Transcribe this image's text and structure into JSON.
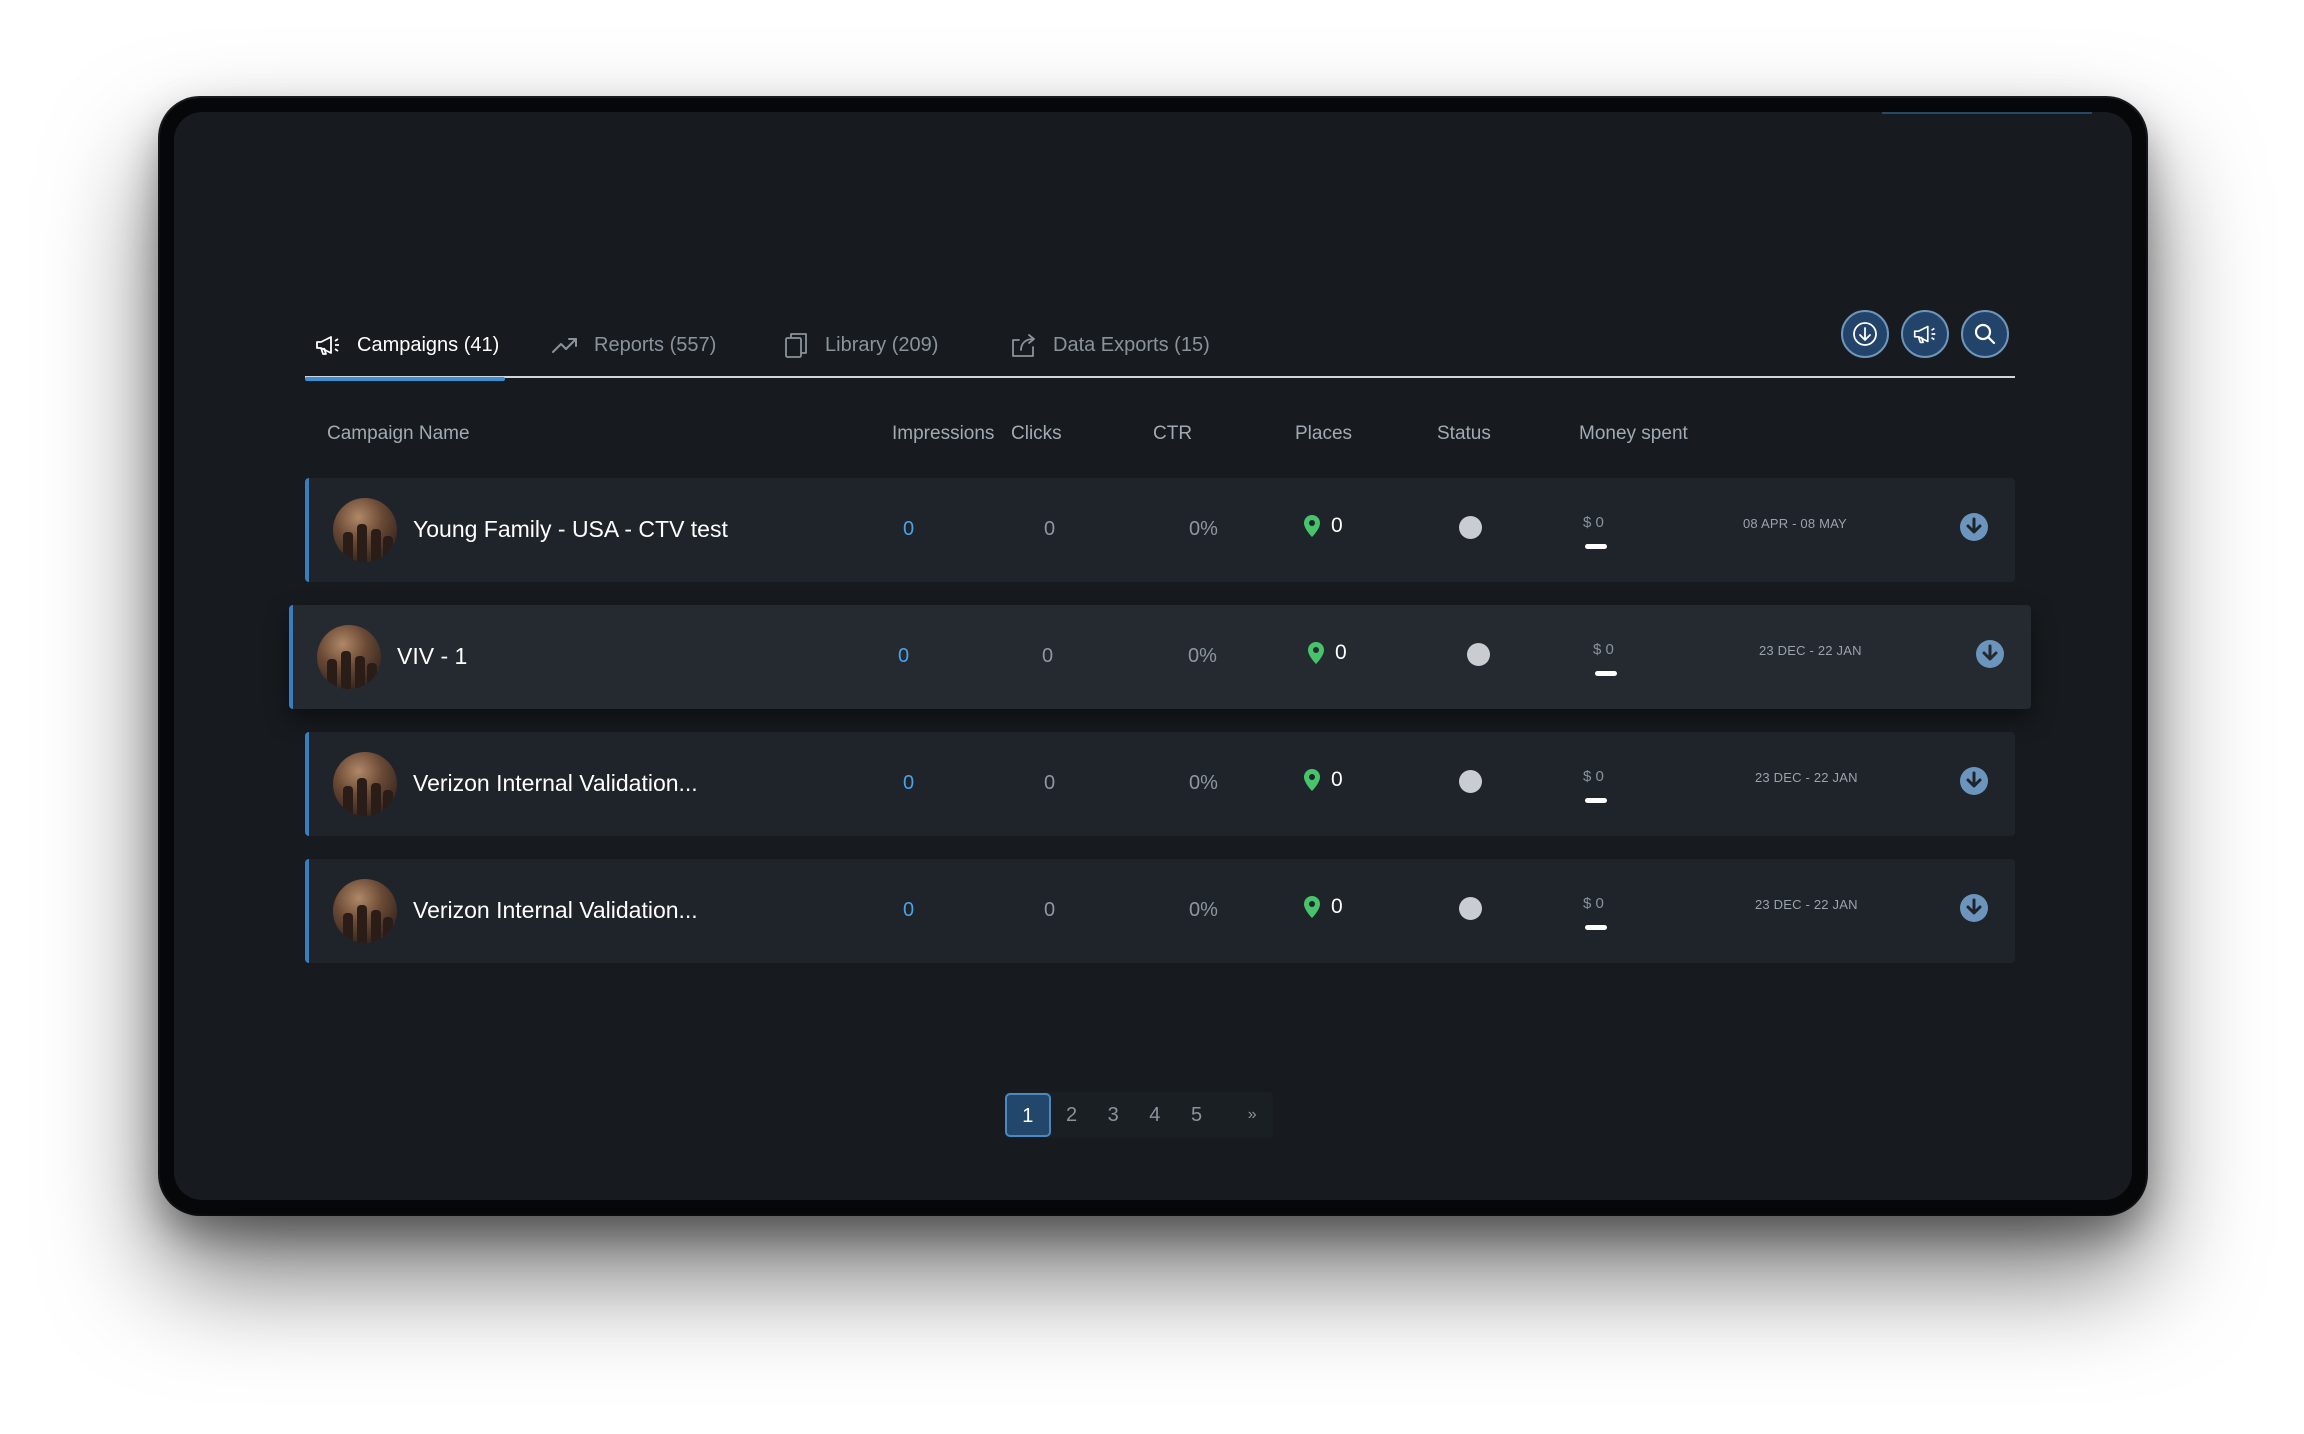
{
  "tabs": [
    {
      "label": "Campaigns (41)",
      "icon": "megaphone-icon",
      "active": true
    },
    {
      "label": "Reports (557)",
      "icon": "trend-icon",
      "active": false
    },
    {
      "label": "Library (209)",
      "icon": "copy-icon",
      "active": false
    },
    {
      "label": "Data Exports (15)",
      "icon": "share-icon",
      "active": false
    }
  ],
  "actions": [
    "download-icon",
    "megaphone-icon",
    "search-icon"
  ],
  "table": {
    "headers": [
      "Campaign Name",
      "Impressions",
      "Clicks",
      "CTR",
      "Places",
      "Status",
      "Money spent"
    ],
    "rows": [
      {
        "name": "Young Family - USA - CTV test",
        "impressions": "0",
        "clicks": "0",
        "ctr": "0%",
        "places": "0",
        "money": "$ 0",
        "dates": "08 APR - 08 MAY"
      },
      {
        "name": "VIV - 1",
        "impressions": "0",
        "clicks": "0",
        "ctr": "0%",
        "places": "0",
        "money": "$ 0",
        "dates": "23 DEC - 22 JAN"
      },
      {
        "name": "Verizon Internal Validation...",
        "impressions": "0",
        "clicks": "0",
        "ctr": "0%",
        "places": "0",
        "money": "$ 0",
        "dates": "23 DEC - 22 JAN"
      },
      {
        "name": "Verizon Internal Validation...",
        "impressions": "0",
        "clicks": "0",
        "ctr": "0%",
        "places": "0",
        "money": "$ 0",
        "dates": "23 DEC - 22 JAN"
      }
    ]
  },
  "pagination": {
    "pages": [
      "1",
      "2",
      "3",
      "4",
      "5"
    ],
    "current": "1",
    "next": "»"
  },
  "colors": {
    "accent": "#3c8fd1",
    "impressions": "#4aa2e6",
    "place_pin": "#47c46b",
    "background": "#171b1f",
    "row": "#1f242a"
  }
}
